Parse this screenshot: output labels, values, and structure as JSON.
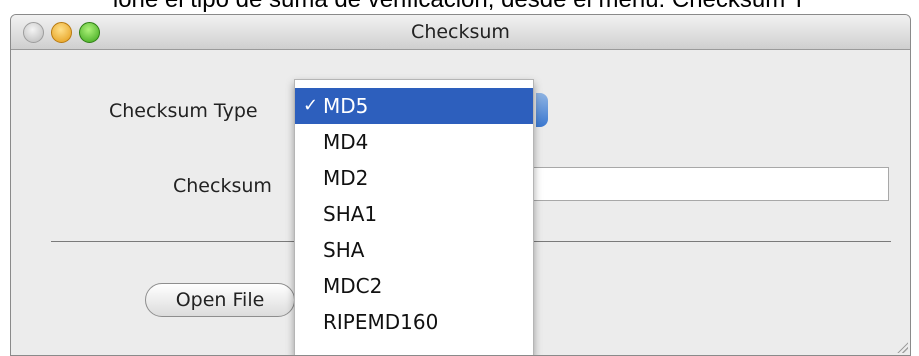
{
  "caption": "ione el tipo de suma de verificación, desde el menú: Checksum T",
  "window": {
    "title": "Checksum"
  },
  "form": {
    "checksum_type_label": "Checksum Type",
    "checksum_label": "Checksum",
    "checksum_value": "",
    "open_file_label": "Open File"
  },
  "dropdown": {
    "selected": "MD5",
    "check_glyph": "✓",
    "options": [
      "MD5",
      "MD4",
      "MD2",
      "SHA1",
      "SHA",
      "MDC2",
      "RIPEMD160"
    ]
  },
  "colors": {
    "selection": "#2d5fbd"
  },
  "icons": {
    "close": "close-icon",
    "minimize": "minimize-icon",
    "zoom": "zoom-icon",
    "check": "checkmark-icon",
    "resize": "resize-grip-icon"
  }
}
